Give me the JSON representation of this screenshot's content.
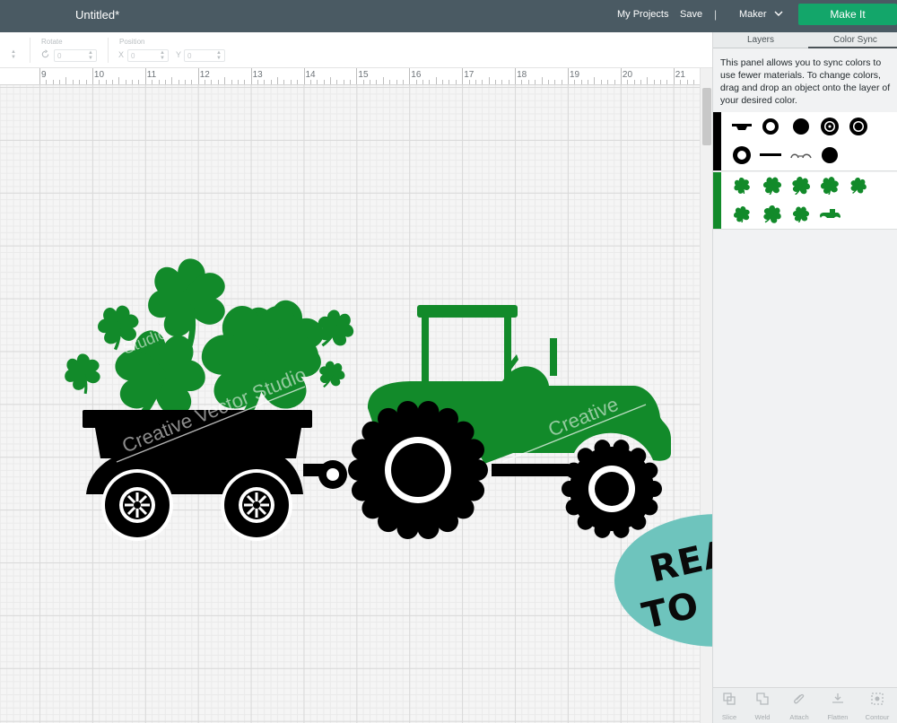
{
  "topbar": {
    "title": "Untitled*",
    "my_projects": "My Projects",
    "save": "Save",
    "separator": "|",
    "machine": "Maker",
    "make_it": "Make It"
  },
  "toolbar": {
    "rotate_label": "Rotate",
    "rotate_value": "0",
    "position_label": "Position",
    "x_label": "X",
    "x_value": "0",
    "y_label": "Y",
    "y_value": "0"
  },
  "ruler": {
    "numbers": [
      "9",
      "10",
      "11",
      "12",
      "13",
      "14",
      "15",
      "16",
      "17",
      "18",
      "19",
      "20",
      "21"
    ]
  },
  "watermark": {
    "text_1": "Creative Vector Studio",
    "text_2": "Creative",
    "text_3": "Studio"
  },
  "badge": {
    "line1": "READY",
    "line2": "TO CUT",
    "color": "#6ec4bd"
  },
  "panel": {
    "tab_layers": "Layers",
    "tab_color_sync": "Color Sync",
    "description": "This panel allows you to sync colors to use fewer materials. To change colors, drag and drop an object onto the layer of your desired color.",
    "groups": [
      {
        "color": "#000000",
        "name": "black-layer-group"
      },
      {
        "color": "#128a2a",
        "name": "green-layer-group"
      }
    ]
  },
  "bottom_tools": {
    "slice": "Slice",
    "weld": "Weld",
    "attach": "Attach",
    "flatten": "Flatten",
    "contour": "Contour"
  },
  "colors": {
    "topbar": "#4a5a63",
    "make_it": "#13a66a",
    "green": "#128a2a",
    "black": "#000000"
  }
}
